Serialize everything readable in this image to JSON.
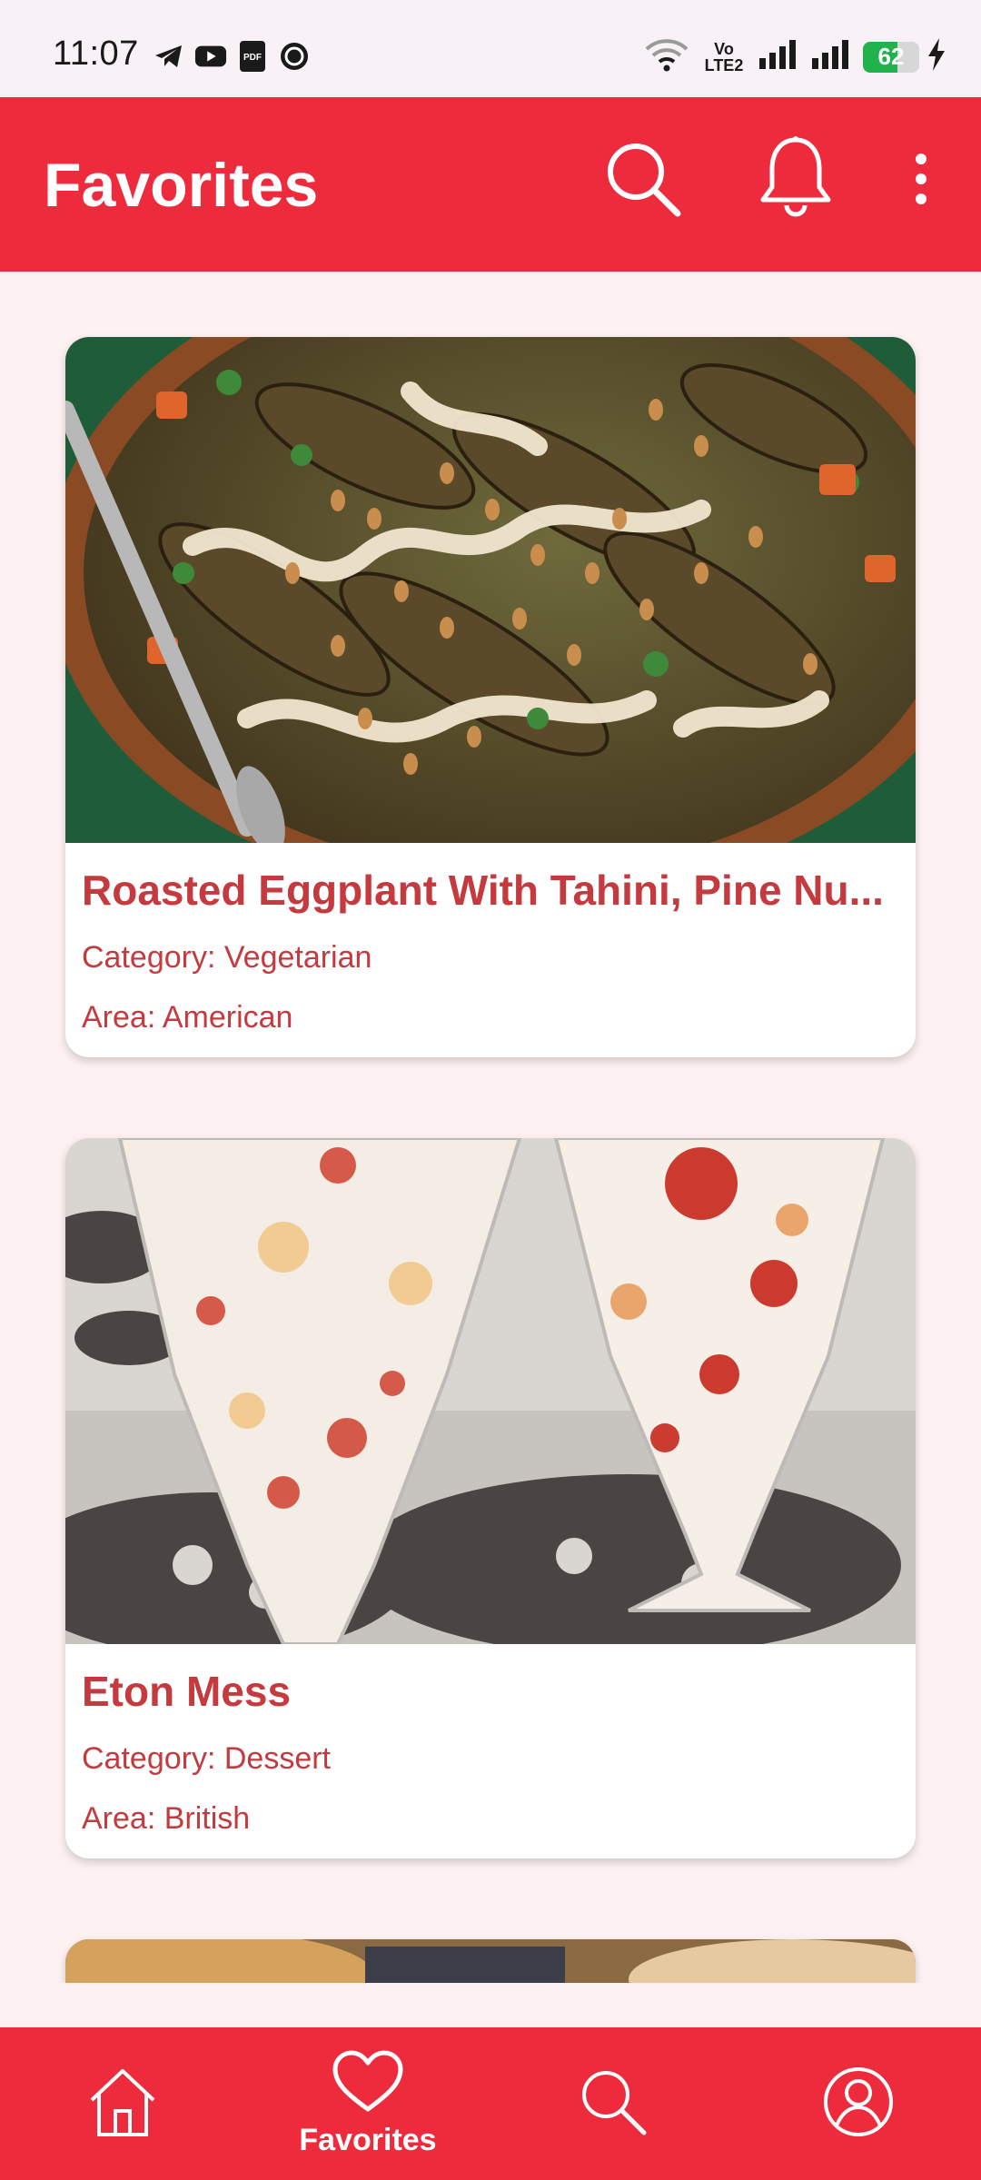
{
  "status_bar": {
    "time": "11:07",
    "app_icons": [
      "telegram-icon",
      "youtube-icon",
      "pdf-icon",
      "whatsapp-icon"
    ],
    "volte_line1": "Vo",
    "volte_line2": "LTE2",
    "battery_percent": 62,
    "battery_label": "62",
    "charging": true
  },
  "app_bar": {
    "title": "Favorites",
    "actions": [
      "search-icon",
      "bell-icon",
      "more-vert-icon"
    ]
  },
  "favorites": [
    {
      "title": "Roasted Eggplant With Tahini, Pine Nu...",
      "category": "Category: Vegetarian",
      "area": "Area: American",
      "image": "roasted-eggplant-dish-photo"
    },
    {
      "title": "Eton Mess",
      "category": "Category: Dessert",
      "area": "Area: British",
      "image": "eton-mess-dessert-photo"
    }
  ],
  "bottom_nav": {
    "items": [
      {
        "icon": "home-icon",
        "label": ""
      },
      {
        "icon": "heart-icon",
        "label": "Favorites"
      },
      {
        "icon": "search-icon",
        "label": ""
      },
      {
        "icon": "profile-icon",
        "label": ""
      }
    ],
    "active_index": 1
  },
  "colors": {
    "brand_red": "#ee2a3d",
    "text_red": "#c43a3e",
    "page_background": "#fdf1f1",
    "battery_green": "#22b24c"
  }
}
